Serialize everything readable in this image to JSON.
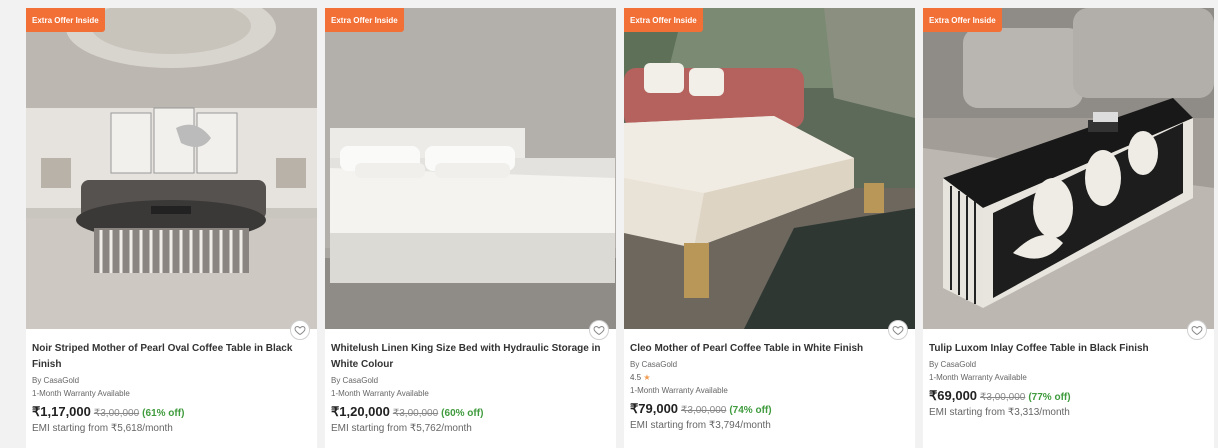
{
  "products": [
    {
      "badge": "Extra Offer Inside",
      "title": "Noir Striped Mother of Pearl Oval Coffee Table in Black Finish",
      "brand": "By CasaGold",
      "rating": "",
      "warranty": "1-Month Warranty Available",
      "price": "₹1,17,000",
      "mrp": "₹3,00,000",
      "discount": "(61% off)",
      "emi": "EMI starting from ₹5,618/month"
    },
    {
      "badge": "Extra Offer Inside",
      "title": "Whitelush Linen King Size Bed with Hydraulic Storage in White Colour",
      "brand": "By CasaGold",
      "rating": "",
      "warranty": "1-Month Warranty Available",
      "price": "₹1,20,000",
      "mrp": "₹3,00,000",
      "discount": "(60% off)",
      "emi": "EMI starting from ₹5,762/month"
    },
    {
      "badge": "Extra Offer Inside",
      "title": "Cleo Mother of Pearl Coffee Table in White Finish",
      "brand": "By CasaGold",
      "rating": "4.5",
      "warranty": "1-Month Warranty Available",
      "price": "₹79,000",
      "mrp": "₹3,00,000",
      "discount": "(74% off)",
      "emi": "EMI starting from ₹3,794/month"
    },
    {
      "badge": "Extra Offer Inside",
      "title": "Tulip Luxom Inlay Coffee Table in Black Finish",
      "brand": "By CasaGold",
      "rating": "",
      "warranty": "1-Month Warranty Available",
      "price": "₹69,000",
      "mrp": "₹3,00,000",
      "discount": "(77% off)",
      "emi": "EMI starting from ₹3,313/month"
    }
  ],
  "icons": {
    "wishlist": "heart-outline-icon",
    "rating": "star-icon"
  },
  "colors": {
    "badge": "#f26f35",
    "discount": "#3f9b3d",
    "star": "#f29c50"
  }
}
